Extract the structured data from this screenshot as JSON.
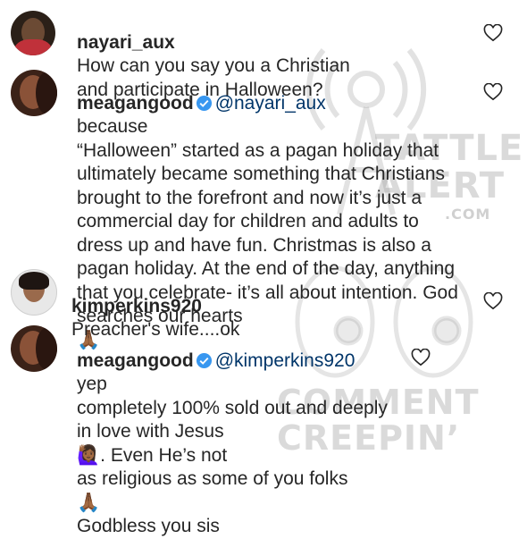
{
  "comments": [
    {
      "username": "nayari_aux",
      "mention": "",
      "text": "How can you say you a Christian\nand participate in Halloween?",
      "verified": false
    },
    {
      "username": "meagangood",
      "mention": "@nayari_aux",
      "text": "because\n“Halloween” started as a pagan holiday that\nultimately became something that Christians\nbrought to the forefront and now it’s just a\ncommercial day for children and adults to\ndress up and have fun. Christmas is also a\npagan holiday. At the end of the day, anything\nthat you celebrate- it’s all about intention. God\nsearches our hearts",
      "emoji": "🙏🏾",
      "verified": true
    },
    {
      "username": "kimperkins920",
      "mention": "",
      "text": "Preacher's wife....ok",
      "verified": false
    },
    {
      "username": "meagangood",
      "mention": "@kimperkins920",
      "text": "yep\ncompletely 100% sold out and deeply\nin love with Jesus",
      "emoji_mid": "🙋🏾‍♀️",
      "text_after": ". Even He’s not\nas religious as some of you folks",
      "emoji": "🙏🏾",
      "text_end": "\nGodbless you sis",
      "verified": true
    }
  ],
  "watermarks": {
    "top": "TATTLER\nALERT",
    "top_small": ".COM",
    "bottom": "COMMENT\nCREEPIN’"
  },
  "icons": {
    "like": "heart-outline-icon",
    "verified": "verified-badge-icon"
  },
  "colors": {
    "text": "#262626",
    "verified_blue": "#3897f0",
    "mention": "#003569",
    "heart_stroke": "#262626"
  }
}
